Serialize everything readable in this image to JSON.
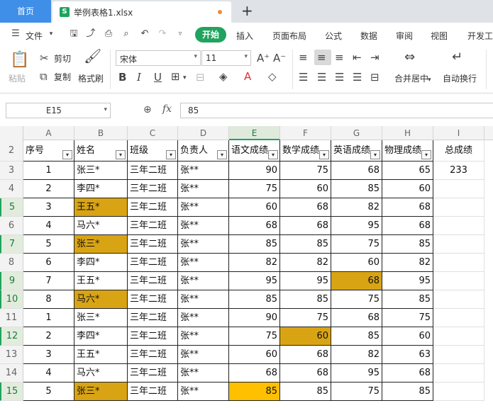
{
  "tabs": {
    "home": "首页",
    "file": "举例表格1.xlsx",
    "file_icon": "S",
    "new": "+"
  },
  "menu": {
    "file": "文件",
    "items": [
      "开始",
      "插入",
      "页面布局",
      "公式",
      "数据",
      "审阅",
      "视图",
      "开发工"
    ]
  },
  "ribbon": {
    "paste": "粘贴",
    "cut": "剪切",
    "copy": "复制",
    "format_painter": "格式刷",
    "font_name": "宋体",
    "font_size": "11",
    "merge_center": "合并居中",
    "wrap_text": "自动换行"
  },
  "formula_bar": {
    "cell_ref": "E15",
    "fx": "fx",
    "value": "85"
  },
  "columns": [
    "A",
    "B",
    "C",
    "D",
    "E",
    "F",
    "G",
    "H",
    "I"
  ],
  "selected_column": "E",
  "header_row": {
    "row_number": "2",
    "cells": [
      "序号",
      "姓名",
      "班级",
      "负责人",
      "语文成绩",
      "数学成绩",
      "英语成绩",
      "物理成绩",
      "总成绩"
    ]
  },
  "rows": [
    {
      "n": "3",
      "cells": [
        "1",
        "张三*",
        "三年二班",
        "张**",
        "90",
        "75",
        "68",
        "65",
        "233"
      ],
      "sel": false,
      "hl": []
    },
    {
      "n": "4",
      "cells": [
        "2",
        "李四*",
        "三年二班",
        "张**",
        "75",
        "60",
        "85",
        "60",
        ""
      ],
      "sel": false,
      "hl": []
    },
    {
      "n": "5",
      "cells": [
        "3",
        "王五*",
        "三年二班",
        "张**",
        "60",
        "68",
        "82",
        "68",
        ""
      ],
      "sel": true,
      "hl": [
        1
      ]
    },
    {
      "n": "6",
      "cells": [
        "4",
        "马六*",
        "三年二班",
        "张**",
        "68",
        "68",
        "95",
        "68",
        ""
      ],
      "sel": false,
      "hl": []
    },
    {
      "n": "7",
      "cells": [
        "5",
        "张三*",
        "三年二班",
        "张**",
        "85",
        "85",
        "75",
        "85",
        ""
      ],
      "sel": true,
      "hl": [
        1
      ]
    },
    {
      "n": "8",
      "cells": [
        "6",
        "李四*",
        "三年二班",
        "张**",
        "82",
        "82",
        "60",
        "82",
        ""
      ],
      "sel": false,
      "hl": []
    },
    {
      "n": "9",
      "cells": [
        "7",
        "王五*",
        "三年二班",
        "张**",
        "95",
        "95",
        "68",
        "95",
        ""
      ],
      "sel": true,
      "hl": [
        6
      ]
    },
    {
      "n": "10",
      "cells": [
        "8",
        "马六*",
        "三年二班",
        "张**",
        "85",
        "85",
        "75",
        "85",
        ""
      ],
      "sel": true,
      "hl": [
        1
      ]
    },
    {
      "n": "11",
      "cells": [
        "1",
        "张三*",
        "三年二班",
        "张**",
        "90",
        "75",
        "68",
        "75",
        ""
      ],
      "sel": false,
      "hl": []
    },
    {
      "n": "12",
      "cells": [
        "2",
        "李四*",
        "三年二班",
        "张**",
        "75",
        "60",
        "85",
        "60",
        ""
      ],
      "sel": true,
      "hl": [
        5
      ]
    },
    {
      "n": "13",
      "cells": [
        "3",
        "王五*",
        "三年二班",
        "张**",
        "60",
        "68",
        "82",
        "63",
        ""
      ],
      "sel": false,
      "hl": []
    },
    {
      "n": "14",
      "cells": [
        "4",
        "马六*",
        "三年二班",
        "张**",
        "68",
        "68",
        "95",
        "68",
        ""
      ],
      "sel": false,
      "hl": []
    },
    {
      "n": "15",
      "cells": [
        "5",
        "张三*",
        "三年二班",
        "张**",
        "85",
        "85",
        "75",
        "85",
        ""
      ],
      "sel": true,
      "hl": [
        1,
        4
      ]
    }
  ],
  "colors": {
    "accent": "#20a35e",
    "highlight": "#d9a414",
    "active_cell": "#ffc000",
    "home_tab": "#3f8fe8"
  }
}
